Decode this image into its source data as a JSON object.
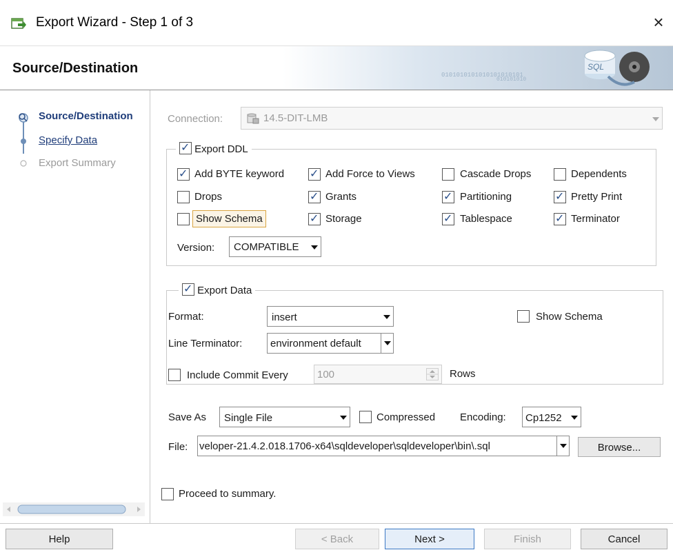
{
  "window": {
    "title": "Export Wizard - Step 1 of 3",
    "close_glyph": "×"
  },
  "header": {
    "title": "Source/Destination"
  },
  "nav": {
    "items": [
      {
        "label": "Source/Destination",
        "state": "current"
      },
      {
        "label": "Specify Data",
        "state": "link"
      },
      {
        "label": "Export Summary",
        "state": "disabled"
      }
    ]
  },
  "connection": {
    "label": "Connection:",
    "value": "14.5-DIT-LMB"
  },
  "export_ddl": {
    "legend": "Export DDL",
    "checked": true,
    "options": [
      {
        "label": "Add BYTE keyword",
        "checked": true
      },
      {
        "label": "Add Force to Views",
        "checked": true
      },
      {
        "label": "Cascade Drops",
        "checked": false
      },
      {
        "label": "Dependents",
        "checked": false
      },
      {
        "label": "Drops",
        "checked": false
      },
      {
        "label": "Grants",
        "checked": true
      },
      {
        "label": "Partitioning",
        "checked": true
      },
      {
        "label": "Pretty Print",
        "checked": true
      },
      {
        "label": "Show Schema",
        "checked": false
      },
      {
        "label": "Storage",
        "checked": true
      },
      {
        "label": "Tablespace",
        "checked": true
      },
      {
        "label": "Terminator",
        "checked": true
      }
    ],
    "version_label": "Version:",
    "version_value": "COMPATIBLE"
  },
  "export_data": {
    "legend": "Export Data",
    "checked": true,
    "format_label": "Format:",
    "format_value": "insert",
    "show_schema_label": "Show Schema",
    "show_schema_checked": false,
    "line_terminator_label": "Line Terminator:",
    "line_terminator_value": "environment default",
    "include_commit_label": "Include Commit Every",
    "include_commit_checked": false,
    "commit_value": "100",
    "rows_label": "Rows"
  },
  "save": {
    "save_as_label": "Save As",
    "save_as_value": "Single File",
    "compressed_label": "Compressed",
    "compressed_checked": false,
    "encoding_label": "Encoding:",
    "encoding_value": "Cp1252",
    "file_label": "File:",
    "file_value": "veloper-21.4.2.018.1706-x64\\sqldeveloper\\sqldeveloper\\bin\\.sql",
    "browse_label": "Browse..."
  },
  "proceed": {
    "label": "Proceed to summary.",
    "checked": false
  },
  "buttons": {
    "help": "Help",
    "back": "< Back",
    "next": "Next >",
    "finish": "Finish",
    "cancel": "Cancel"
  },
  "colors": {
    "accent": "#2a4f8a",
    "nav_link": "#1f3d7a",
    "disabled_text": "#9a9a9a"
  }
}
